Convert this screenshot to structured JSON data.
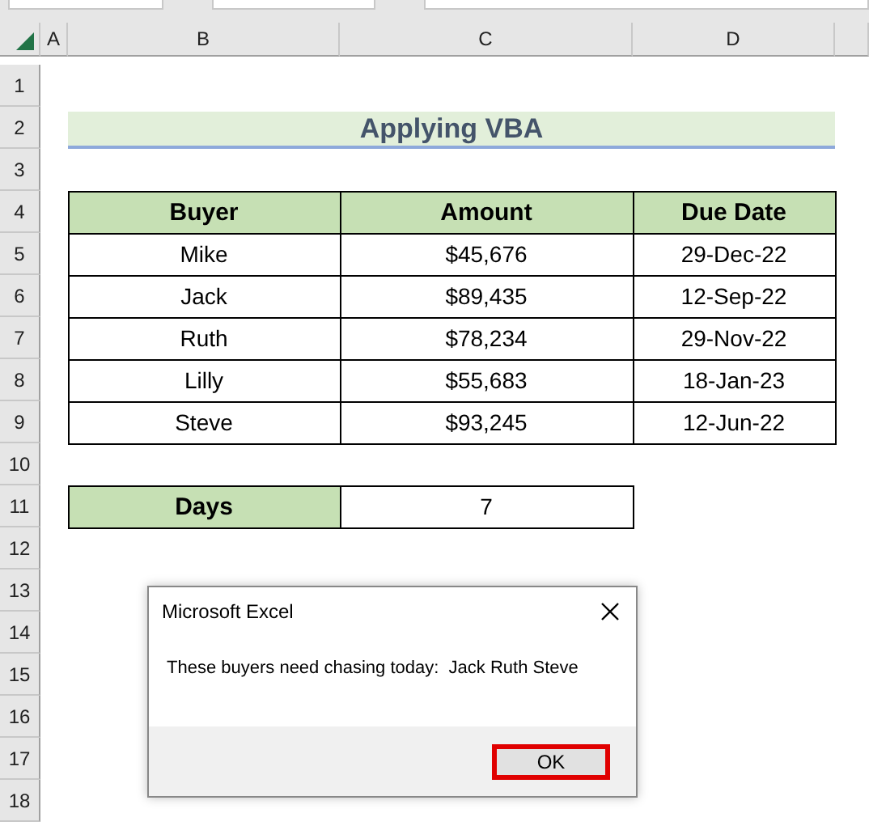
{
  "sheet": {
    "columns": [
      "A",
      "B",
      "C",
      "D"
    ],
    "row_numbers": [
      "1",
      "2",
      "3",
      "4",
      "5",
      "6",
      "7",
      "8",
      "9",
      "10",
      "11",
      "12",
      "13",
      "14",
      "15",
      "16",
      "17",
      "18"
    ],
    "title": "Applying VBA",
    "table": {
      "columns": [
        "Buyer",
        "Amount",
        "Due Date"
      ],
      "rows": [
        [
          "Mike",
          "$45,676",
          "29-Dec-22"
        ],
        [
          "Jack",
          "$89,435",
          "12-Sep-22"
        ],
        [
          "Ruth",
          "$78,234",
          "29-Nov-22"
        ],
        [
          "Lilly",
          "$55,683",
          "18-Jan-23"
        ],
        [
          "Steve",
          "$93,245",
          "12-Jun-22"
        ]
      ]
    },
    "days": {
      "label": "Days",
      "value": "7"
    }
  },
  "dialog": {
    "title": "Microsoft Excel",
    "message": "These buyers need chasing today:  Jack Ruth Steve",
    "button": {
      "label": "OK",
      "highlighted": true
    }
  }
}
